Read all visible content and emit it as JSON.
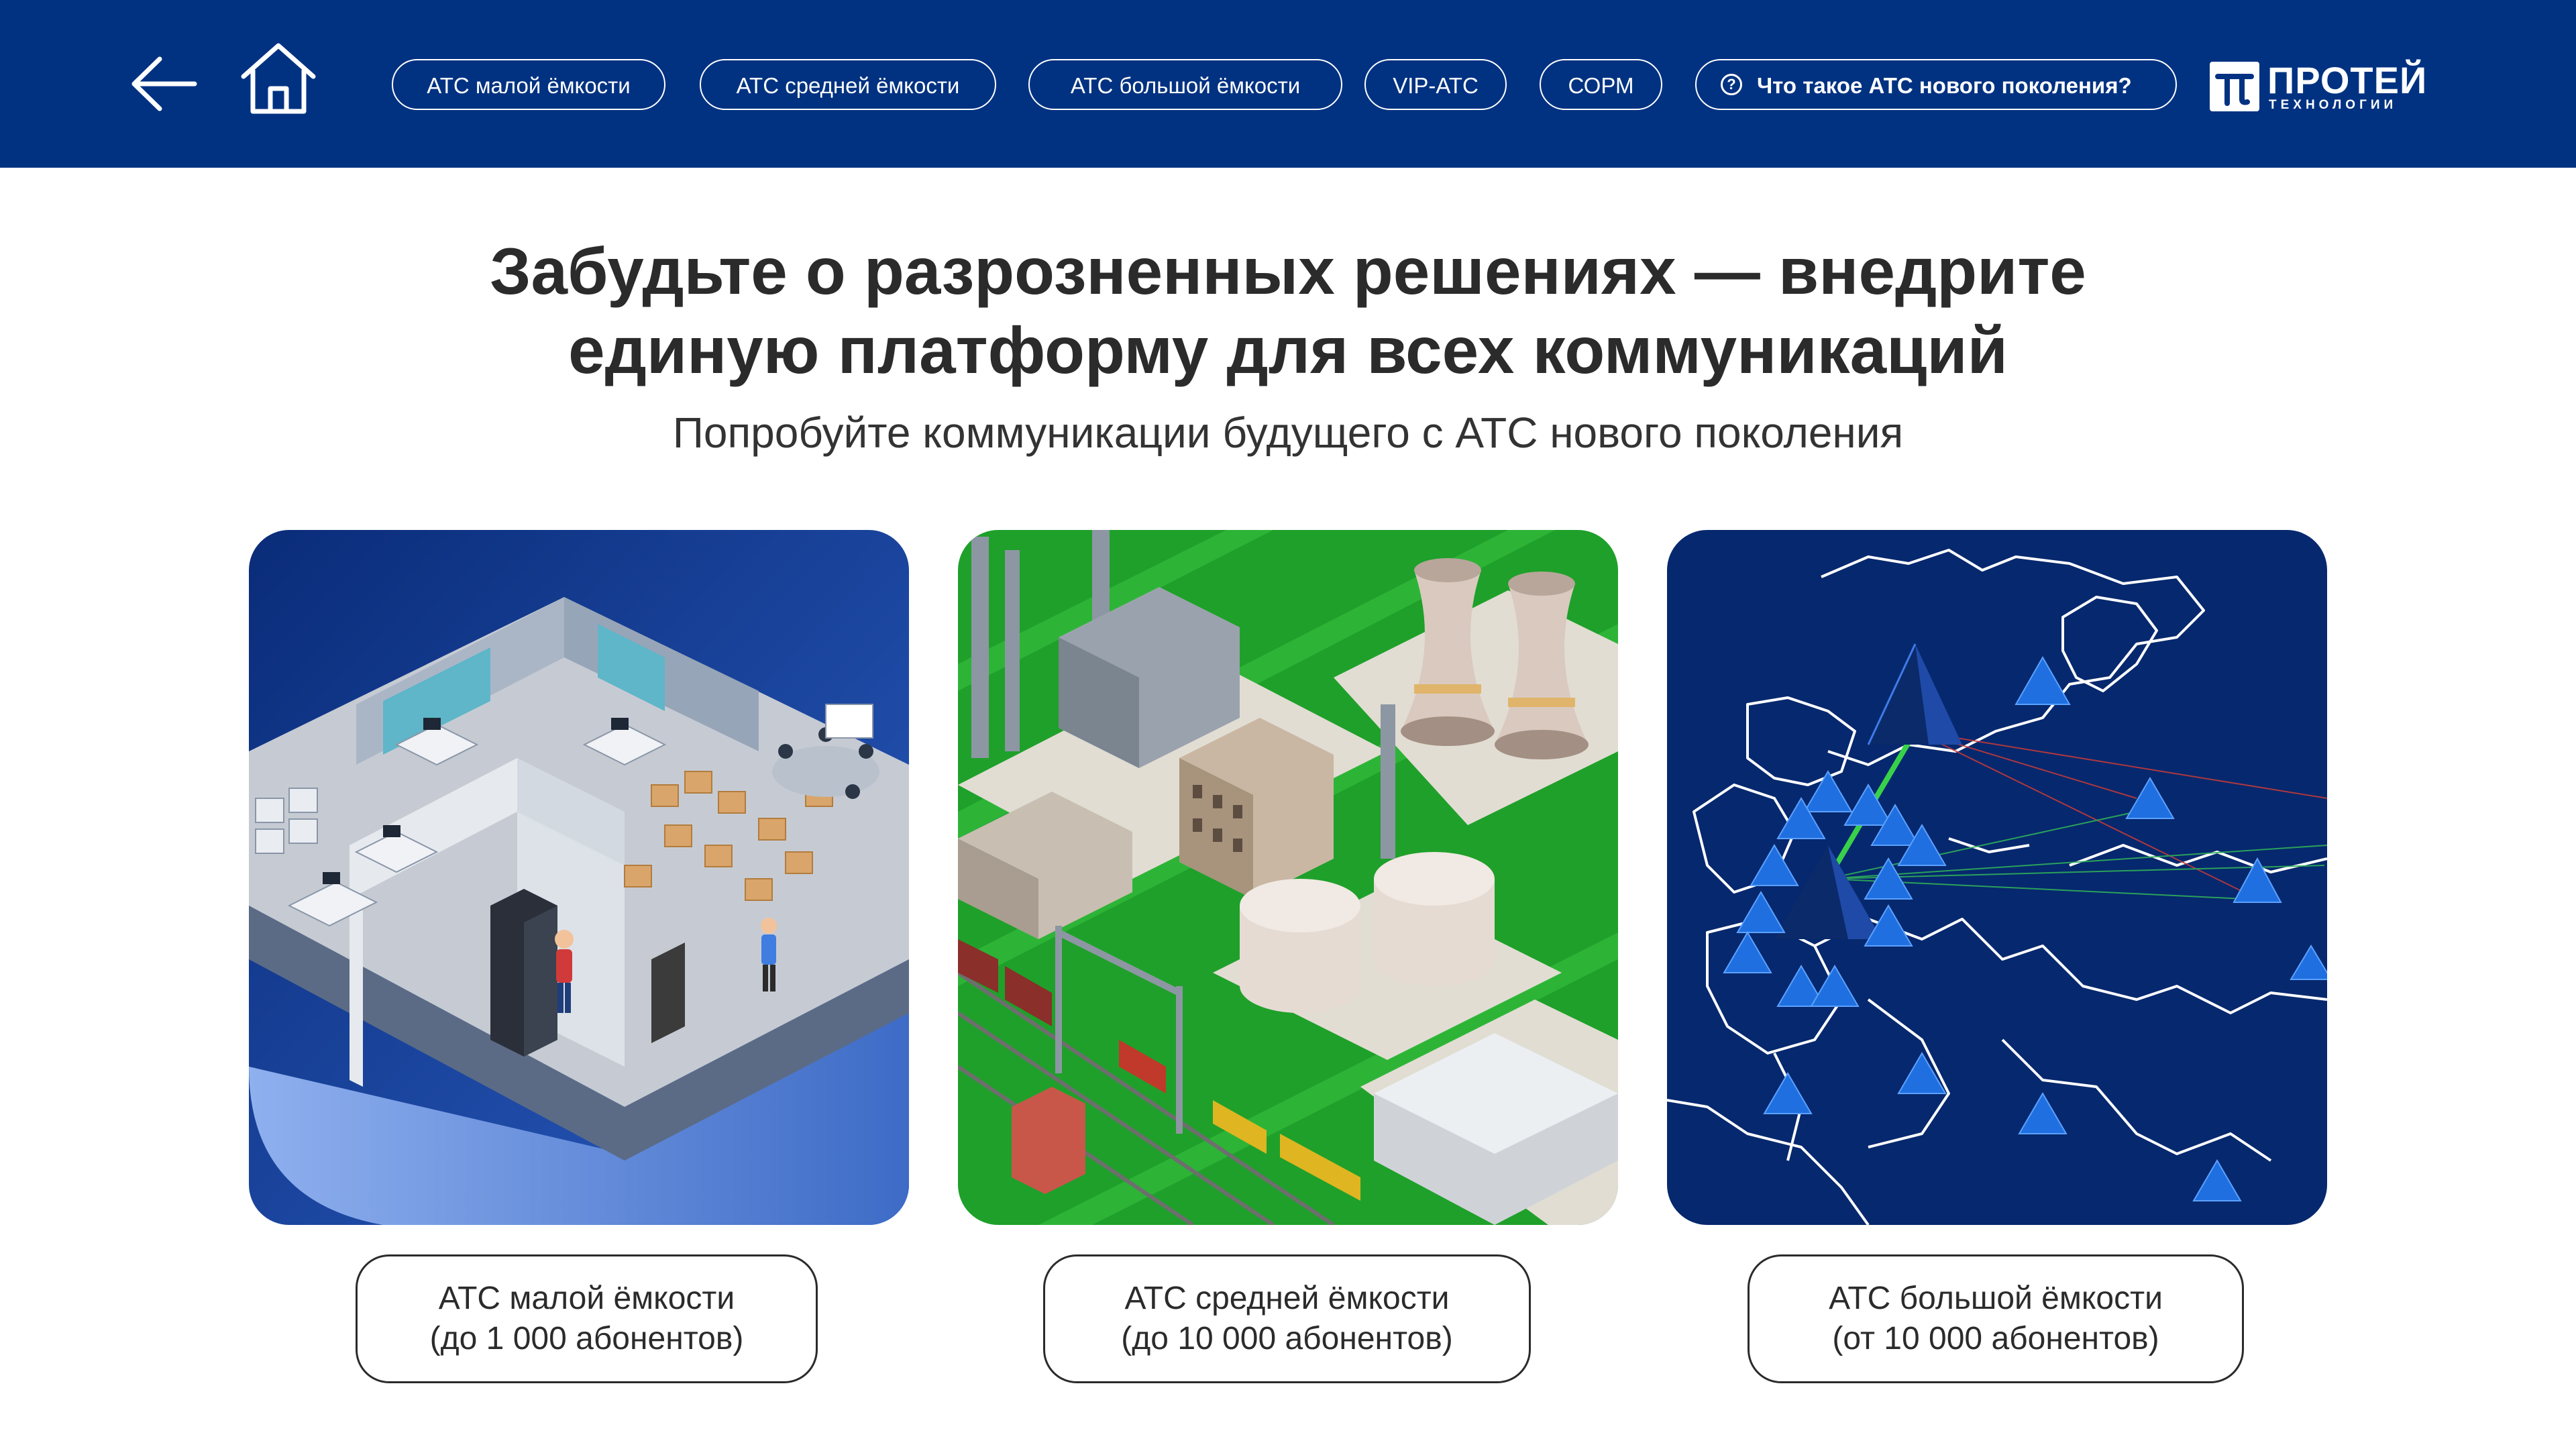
{
  "nav": {
    "pills": [
      {
        "label": "АТС малой ёмкости"
      },
      {
        "label": "АТС средней ёмкости"
      },
      {
        "label": "АТС большой ёмкости"
      },
      {
        "label": "VIP-АТС"
      },
      {
        "label": "СОРМ"
      }
    ],
    "help_label": "Что такое АТС нового поколения?",
    "help_icon": "question-circle-icon"
  },
  "logo": {
    "name": "ПРОТЕЙ",
    "sub": "ТЕХНОЛОГИИ",
    "mark": "π"
  },
  "headline": {
    "line1": "Забудьте о разрозненных решениях — внедрите",
    "line2": "единую платформу для всех коммуникаций"
  },
  "subheadline": "Попробуйте коммуникации будущего с АТС нового поколения",
  "cards": [
    {
      "line1": "АТС малой ёмкости",
      "line2": "(до 1 000 абонентов)",
      "illustration": "isometric-office"
    },
    {
      "line1": "АТС средней ёмкости",
      "line2": "(до 10 000 абонентов)",
      "illustration": "isometric-industrial-plant"
    },
    {
      "line1": "АТС большой ёмкости",
      "line2": "(от 10 000 абонентов)",
      "illustration": "network-map"
    }
  ],
  "colors": {
    "header_bg": "#003281",
    "map_bg": "#06286e",
    "pyramid_blue": "#1f6fe0",
    "grass_green": "#1fa02a",
    "text_dark": "#2b2b2b"
  }
}
